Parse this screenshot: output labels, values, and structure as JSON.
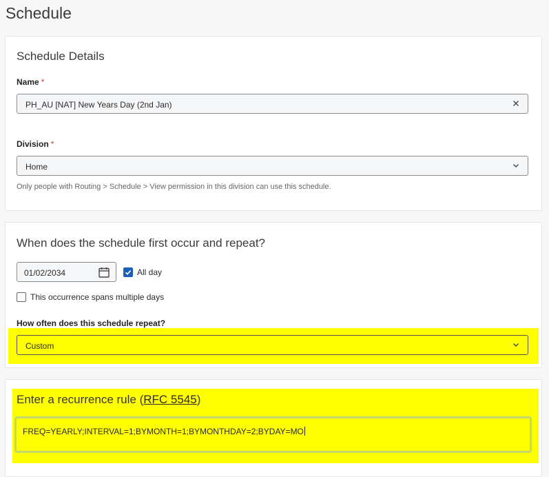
{
  "page": {
    "title": "Schedule"
  },
  "details": {
    "title": "Schedule Details",
    "name_label": "Name",
    "name_required": "*",
    "name_value": "PH_AU [NAT] New Years Day (2nd Jan)",
    "division_label": "Division",
    "division_required": "*",
    "division_value": "Home",
    "division_hint": "Only people with Routing > Schedule > View permission in this division can use this schedule."
  },
  "occurrence": {
    "title": "When does the schedule first occur and repeat?",
    "date_value": "01/02/2034",
    "all_day_label": "All day",
    "all_day_checked": true,
    "multi_day_label": "This occurrence spans multiple days",
    "multi_day_checked": false,
    "repeat_label": "How often does this schedule repeat?",
    "repeat_value": "Custom"
  },
  "recurrence": {
    "title_prefix": "Enter a recurrence rule (",
    "title_link": "RFC 5545",
    "title_suffix": ")",
    "rule_value": "FREQ=YEARLY;INTERVAL=1;BYMONTH=1;BYMONTHDAY=2;BYDAY=MO"
  },
  "icons": {
    "clear": "close-icon",
    "dropdown": "chevron-down-icon",
    "calendar": "calendar-icon",
    "check": "check-icon"
  },
  "colors": {
    "highlight": "#ffff00",
    "checkbox_accent": "#1e5fb8",
    "required": "#d23a3a"
  }
}
